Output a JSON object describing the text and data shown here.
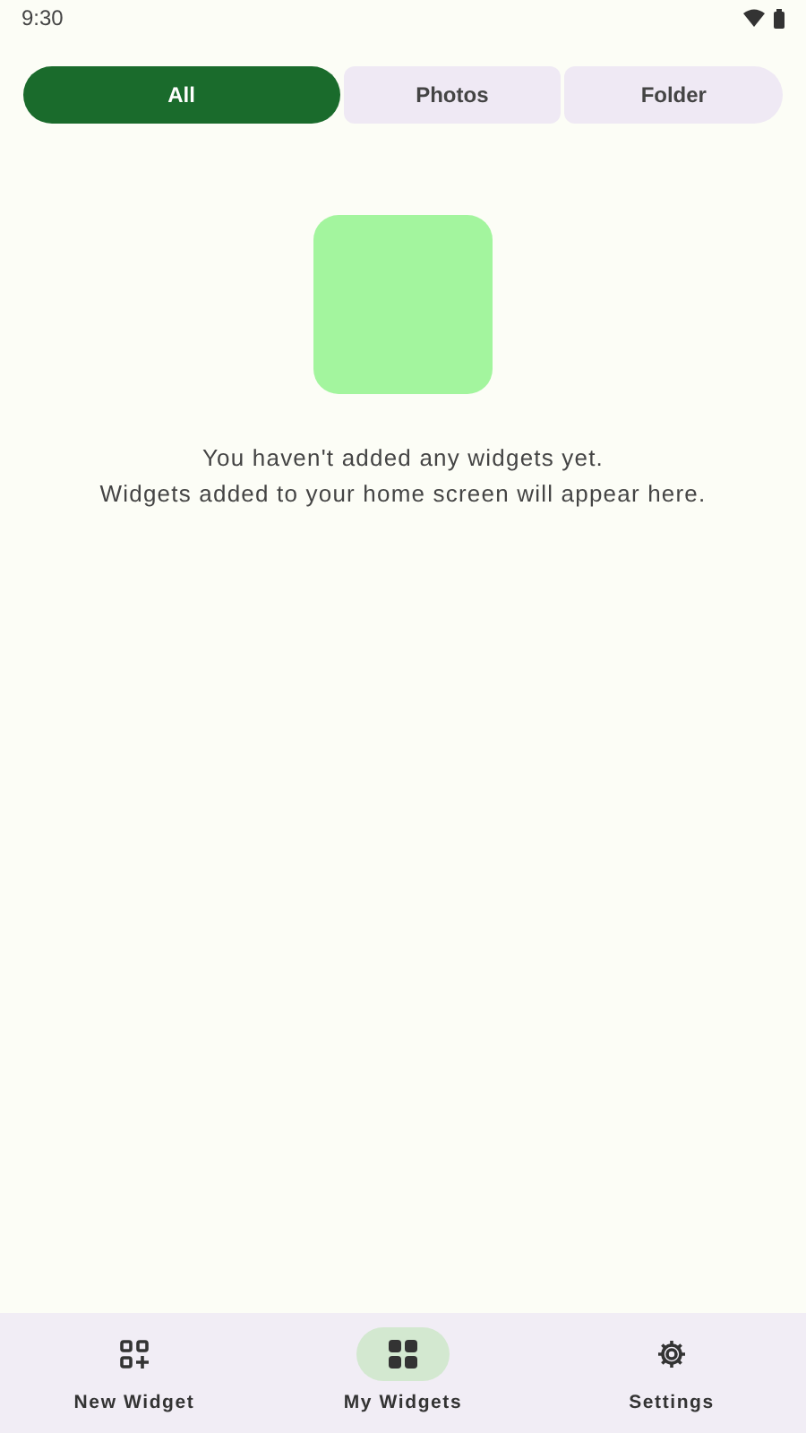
{
  "status_bar": {
    "time": "9:30"
  },
  "tabs": [
    {
      "label": "All",
      "selected": true
    },
    {
      "label": "Photos",
      "selected": false
    },
    {
      "label": "Folder",
      "selected": false
    }
  ],
  "empty_state": {
    "lines": [
      "You haven't added any widgets yet.",
      "Widgets added to your home screen will appear here."
    ]
  },
  "bottom_nav": [
    {
      "label": "New Widget",
      "kind": "new",
      "selected": false
    },
    {
      "label": "My Widgets",
      "kind": "grid",
      "selected": true
    },
    {
      "label": "Settings",
      "kind": "settings",
      "selected": false
    }
  ]
}
